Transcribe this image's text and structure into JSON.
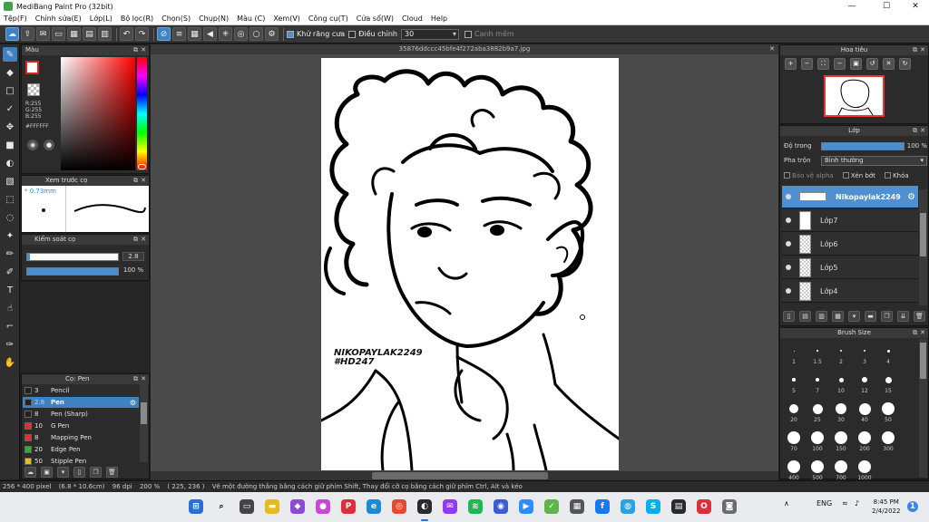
{
  "window": {
    "title": "MediBang Paint Pro (32bit)",
    "minimize": "—",
    "maximize": "☐",
    "close": "✕"
  },
  "menu": [
    "Tệp(F)",
    "Chỉnh sửa(E)",
    "Lớp(L)",
    "Bộ lọc(R)",
    "Chọn(S)",
    "Chụp(N)",
    "Màu (C)",
    "Xem(V)",
    "Công cụ(T)",
    "Cửa sổ(W)",
    "Cloud",
    "Help"
  ],
  "toolbar": {
    "antialias_label": "Khử răng cưa",
    "adjust_label": "Điều chỉnh",
    "adjust_value": "30",
    "snap_label": "Cạnh mềm"
  },
  "color_panel": {
    "title": "Màu",
    "r": "R:255",
    "g": "G:255",
    "b": "B:255",
    "hex": "#FFFFFF"
  },
  "brush_preview": {
    "title": "Xem trước cọ",
    "size": "* 0.73mm"
  },
  "brush_control": {
    "title": "Kiểm soát cọ",
    "size_value": "2.8",
    "opacity_value": "100 %",
    "size_fraction": 0.03,
    "opacity_fraction": 1.0
  },
  "brush_list": {
    "title": "Cọ: Pen",
    "items": [
      {
        "size": "3",
        "name": "Pencil",
        "color": "#222222"
      },
      {
        "size": "2.8",
        "name": "Pen",
        "color": "#222222",
        "selected": true
      },
      {
        "size": "8",
        "name": "Pen (Sharp)",
        "color": "#222222"
      },
      {
        "size": "10",
        "name": "G Pen",
        "color": "#e03030"
      },
      {
        "size": "8",
        "name": "Mapping Pen",
        "color": "#e03030"
      },
      {
        "size": "20",
        "name": "Edge Pen",
        "color": "#30b030"
      },
      {
        "size": "50",
        "name": "Stipple Pen",
        "color": "#e0c020"
      }
    ]
  },
  "document": {
    "tab": "35876ddccc45bfe4f272aba3882b9a7.jpg",
    "watermark_line1": "NIKOPAYLAK2249",
    "watermark_line2": "#HD247"
  },
  "navigator": {
    "title": "Hoa tiêu"
  },
  "layers": {
    "title": "Lớp",
    "opacity_label": "Độ trong",
    "opacity_value": "100 %",
    "opacity_fraction": 1.0,
    "blend_label": "Pha trộn",
    "blend_value": "Bình thường",
    "protect_alpha": "Bảo vệ alpha",
    "clip": "Xén bớt",
    "lock": "Khóa",
    "items": [
      {
        "name": "Nikopaylak2249",
        "selected": true
      },
      {
        "name": "Lớp7"
      },
      {
        "name": "Lớp6"
      },
      {
        "name": "Lớp5"
      },
      {
        "name": "Lớp4"
      }
    ]
  },
  "brush_size": {
    "title": "Brush Size",
    "sizes": [
      "1",
      "1.5",
      "2",
      "3",
      "4",
      "5",
      "7",
      "10",
      "12",
      "15",
      "20",
      "25",
      "30",
      "40",
      "50",
      "70",
      "100",
      "150",
      "200",
      "300",
      "400",
      "500",
      "700",
      "1000"
    ]
  },
  "status": {
    "pixels": "256 * 400 pixel",
    "cm": "(6.8 * 10.6cm)",
    "dpi": "96 dpi",
    "zoom": "200 %",
    "coords": "( 225, 236 )",
    "hint": "Vẽ một đường thẳng bằng cách giữ phím Shift, Thay đổi cỡ cọ bằng cách giữ phím Ctrl, Alt và kéo"
  },
  "taskbar": {
    "lang": "ENG",
    "time": "8:45 PM",
    "date": "2/4/2022",
    "up_arrow": "∧"
  },
  "colors": {
    "accent": "#3e82c4",
    "panel": "#2b2b2b",
    "workspace": "#4a4a4a"
  }
}
